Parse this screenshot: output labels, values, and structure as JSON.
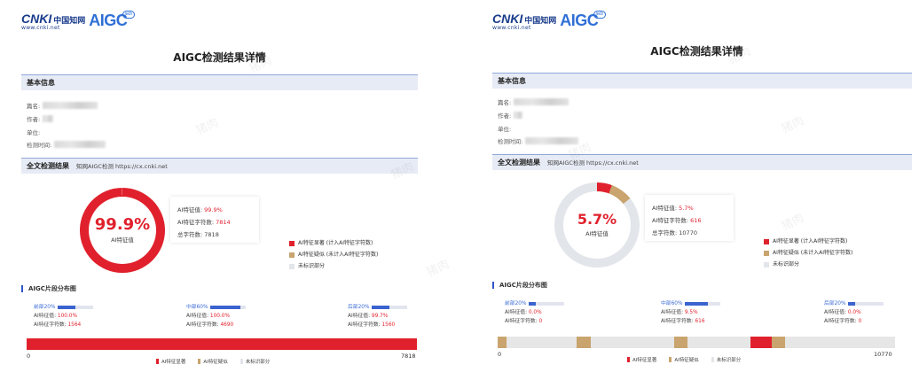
{
  "watermark": "猪肉",
  "colors": {
    "significant": "#e0212d",
    "suspected": "#c9a46e",
    "unmarked": "#e2e5ea",
    "accent": "#2f55c8"
  },
  "reports": [
    {
      "logo": {
        "brand": "CNKI",
        "brand_cn": "中国知网",
        "url": "www.cnki.net",
        "aigc": "AIGC",
        "tag": "tech"
      },
      "title": "AIGC检测结果详情",
      "basic": {
        "section": "基本信息",
        "fields": [
          {
            "label": "篇名:"
          },
          {
            "label": "作者:"
          },
          {
            "label": "单位:"
          },
          {
            "label": "检测时间:"
          }
        ]
      },
      "full": {
        "section": "全文检测结果",
        "note": "知网AIGC检测   https://cx.cnki.net",
        "ring_pct": "99.9%",
        "ring_caption": "AI特征值",
        "ai_value": 0.999,
        "stats": [
          {
            "label": "AI特征值:",
            "value": "99.9%",
            "red": true
          },
          {
            "label": "AI特征字符数:",
            "value": "7814",
            "red": true
          },
          {
            "label": "总字符数:",
            "value": "7818",
            "red": false
          }
        ],
        "legend": [
          {
            "label": "AI特征显著     (计入AI特征字符数)",
            "color": "#e0212d"
          },
          {
            "label": "AI特征疑似     (未计入AI特征字符数)",
            "color": "#c9a46e"
          },
          {
            "label": "未标识部分",
            "color": "#e2e5ea"
          }
        ]
      },
      "distribution": {
        "title": "AIGC片段分布图",
        "segments": [
          {
            "label": "前部20%",
            "fill": 0.5,
            "value_label": "AI特征值:",
            "value": "100.0%",
            "chars_label": "AI特征字符数:",
            "chars": "1564"
          },
          {
            "label": "中部60%",
            "fill": 0.85,
            "value_label": "AI特征值:",
            "value": "100.0%",
            "chars_label": "AI特征字符数:",
            "chars": "4690"
          },
          {
            "label": "后部20%",
            "fill": 0.5,
            "value_label": "AI特征值:",
            "value": "99.7%",
            "chars_label": "AI特征字符数:",
            "chars": "1560"
          }
        ],
        "total_chars": 7818,
        "bar_start": "0",
        "bar_end": "7818",
        "marks": [
          {
            "start": 0,
            "end": 7818,
            "type": "significant"
          }
        ],
        "legend": [
          "AI特征显著",
          "AI特征疑似",
          "未标识部分"
        ]
      }
    },
    {
      "logo": {
        "brand": "CNKI",
        "brand_cn": "中国知网",
        "url": "www.cnki.net",
        "aigc": "AIGC",
        "tag": "tech"
      },
      "title": "AIGC检测结果详情",
      "basic": {
        "section": "基本信息",
        "fields": [
          {
            "label": "篇名:"
          },
          {
            "label": "作者:"
          },
          {
            "label": "单位:"
          },
          {
            "label": "检测时间:"
          }
        ]
      },
      "full": {
        "section": "全文检测结果",
        "note": "知网AIGC检测   https://cx.cnki.net",
        "ring_pct": "5.7%",
        "ring_caption": "AI特征值",
        "ai_value": 0.057,
        "suspect_value": 0.085,
        "stats": [
          {
            "label": "AI特征值:",
            "value": "5.7%",
            "red": true
          },
          {
            "label": "AI特征字符数:",
            "value": "616",
            "red": true
          },
          {
            "label": "总字符数:",
            "value": "10770",
            "red": false
          }
        ],
        "legend": [
          {
            "label": "AI特征显著     (计入AI特征字符数)",
            "color": "#e0212d"
          },
          {
            "label": "AI特征疑似     (未计入AI特征字符数)",
            "color": "#c9a46e"
          },
          {
            "label": "未标识部分",
            "color": "#e2e5ea"
          }
        ]
      },
      "distribution": {
        "title": "AIGC片段分布图",
        "segments": [
          {
            "label": "前部20%",
            "fill": 0.2,
            "value_label": "AI特征值:",
            "value": "0.0%",
            "chars_label": "AI特征字符数:",
            "chars": "0"
          },
          {
            "label": "中部60%",
            "fill": 0.65,
            "value_label": "AI特征值:",
            "value": "9.5%",
            "chars_label": "AI特征字符数:",
            "chars": "616"
          },
          {
            "label": "后部20%",
            "fill": 0.2,
            "value_label": "AI特征值:",
            "value": "0.0%",
            "chars_label": "AI特征字符数:",
            "chars": "0"
          }
        ],
        "total_chars": 10770,
        "bar_start": "0",
        "bar_end": "10770",
        "marks": [
          {
            "start": 0,
            "end": 230,
            "type": "suspected"
          },
          {
            "start": 2150,
            "end": 2520,
            "type": "suspected"
          },
          {
            "start": 4780,
            "end": 5150,
            "type": "suspected"
          },
          {
            "start": 6850,
            "end": 7430,
            "type": "significant"
          },
          {
            "start": 7430,
            "end": 7800,
            "type": "suspected"
          }
        ],
        "legend": [
          "AI特征显著",
          "AI特征疑似",
          "未标识部分"
        ]
      }
    }
  ]
}
